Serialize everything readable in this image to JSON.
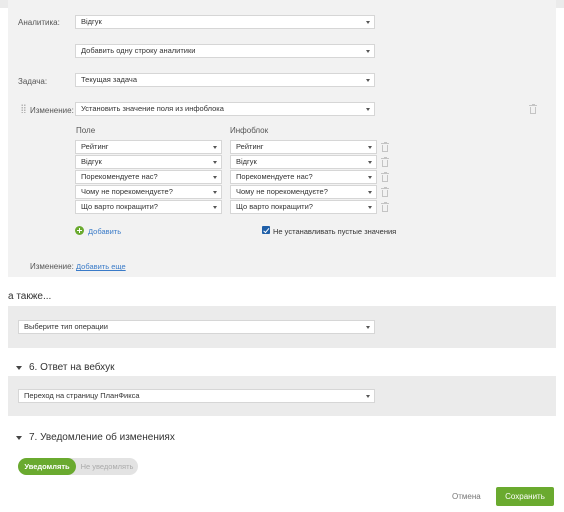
{
  "analytics": {
    "label": "Аналитика:",
    "value": "Відгук",
    "add_row": "Добавить одну строку аналитики"
  },
  "task": {
    "label": "Задача:",
    "value": "Текущая задача"
  },
  "change": {
    "label": "Изменение:",
    "value": "Установить значение поля из инфоблока",
    "col_field": "Поле",
    "col_infoblock": "Инфоблок",
    "rows": [
      {
        "field": "Рейтинг",
        "infoblock": "Рейтинг"
      },
      {
        "field": "Відгук",
        "infoblock": "Відгук"
      },
      {
        "field": "Порекомендуете нас?",
        "infoblock": "Порекомендуете нас?"
      },
      {
        "field": "Чому не порекомендуєте?",
        "infoblock": "Чому не порекомендуєте?"
      },
      {
        "field": "Що варто покращити?",
        "infoblock": "Що варто покращити?"
      }
    ],
    "add_label": "Добавить",
    "skip_empty_label": "Не устанавливать пустые значения",
    "skip_empty_checked": true,
    "more_label": "Изменение:",
    "more_link": "Добавить еще"
  },
  "also": {
    "heading": "а также...",
    "placeholder": "Выберите тип операции"
  },
  "webhook": {
    "heading": "6. Ответ на вебхук",
    "value": "Переход на страницу ПланФикса"
  },
  "notify": {
    "heading": "7. Уведомление об изменениях",
    "on_label": "Уведомлять",
    "off_label": "Не уведомлять",
    "selected": "on"
  },
  "footer": {
    "cancel": "Отмена",
    "save": "Сохранить"
  },
  "colors": {
    "accent_green": "#6aaa2f",
    "link_blue": "#3a7bc8",
    "checkbox_blue": "#1f5fa8"
  }
}
